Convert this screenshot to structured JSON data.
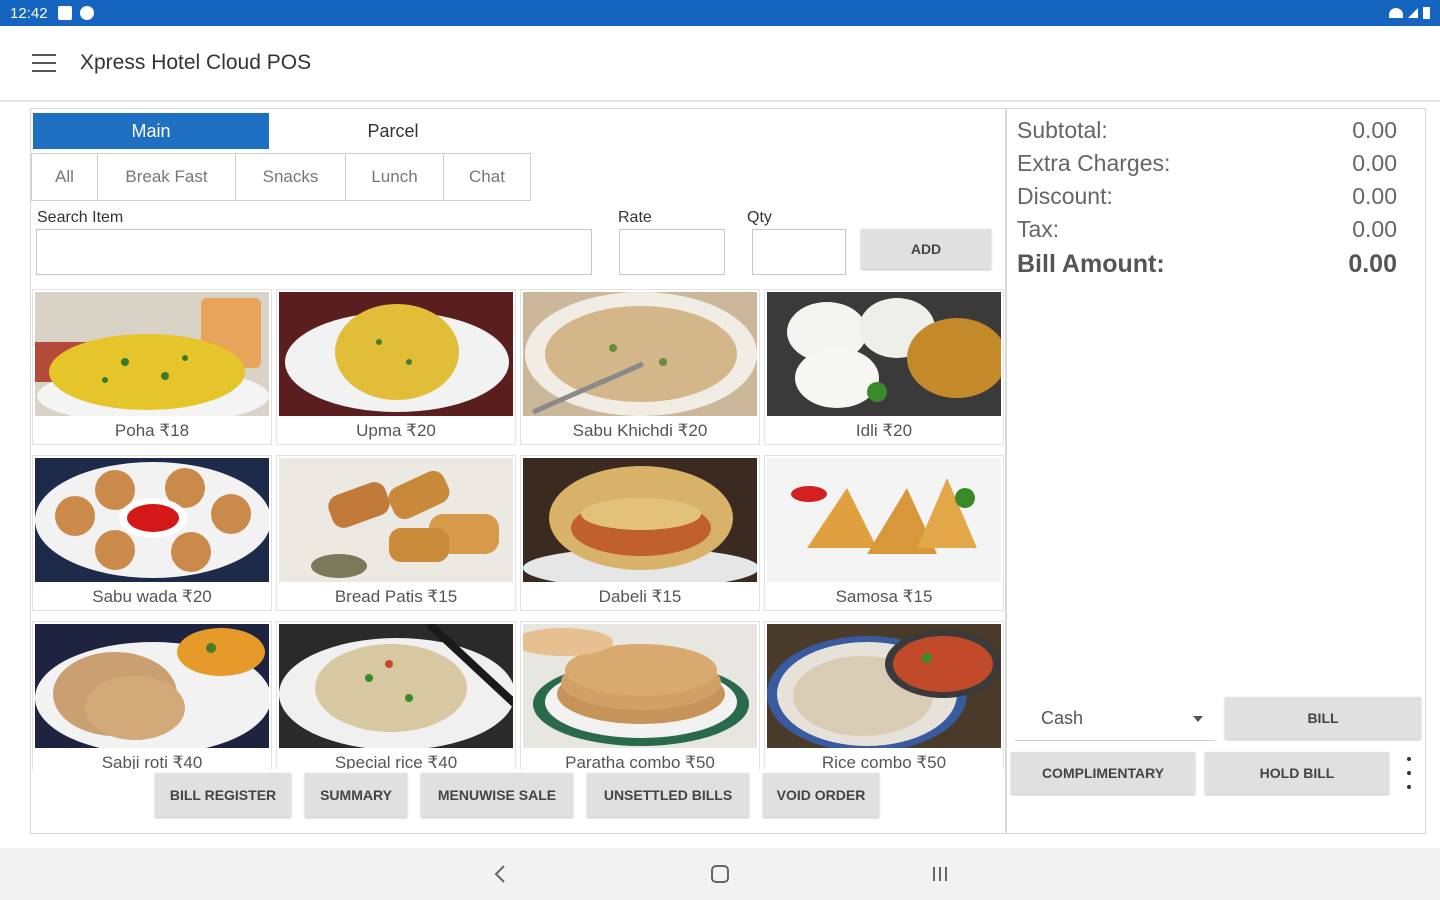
{
  "status_bar": {
    "time": "12:42"
  },
  "app": {
    "title": "Xpress Hotel Cloud POS"
  },
  "order_tabs": [
    "Main",
    "Parcel"
  ],
  "categories": [
    "All",
    "Break Fast",
    "Snacks",
    "Lunch",
    "Chat"
  ],
  "search": {
    "label": "Search Item",
    "value": ""
  },
  "rate": {
    "label": "Rate",
    "value": ""
  },
  "qty": {
    "label": "Qty",
    "value": ""
  },
  "add_label": "ADD",
  "menu_items": [
    {
      "caption": "Poha ₹18"
    },
    {
      "caption": "Upma ₹20"
    },
    {
      "caption": "Sabu Khichdi ₹20"
    },
    {
      "caption": "Idli ₹20"
    },
    {
      "caption": "Sabu wada ₹20"
    },
    {
      "caption": "Bread Patis ₹15"
    },
    {
      "caption": "Dabeli ₹15"
    },
    {
      "caption": "Samosa ₹15"
    },
    {
      "caption": "Sabji roti ₹40"
    },
    {
      "caption": "Special rice ₹40"
    },
    {
      "caption": "Paratha combo ₹50"
    },
    {
      "caption": "Rice combo ₹50"
    }
  ],
  "bottom_buttons": [
    "BILL REGISTER",
    "SUMMARY",
    "MENUWISE SALE",
    "UNSETTLED BILLS",
    "VOID ORDER"
  ],
  "summary": {
    "subtotal_label": "Subtotal:",
    "subtotal_value": "0.00",
    "extra_label": "Extra Charges:",
    "extra_value": "0.00",
    "discount_label": "Discount:",
    "discount_value": "0.00",
    "tax_label": "Tax:",
    "tax_value": "0.00",
    "bill_label": "Bill Amount:",
    "bill_value": "0.00"
  },
  "payment": {
    "selected": "Cash"
  },
  "actions": {
    "bill": "BILL",
    "complimentary": "COMPLIMENTARY",
    "hold_bill": "HOLD BILL"
  },
  "colors": {
    "primary": "#1f6fc3",
    "status_bar": "#1565c0",
    "button_grey": "#e0e0e0"
  }
}
